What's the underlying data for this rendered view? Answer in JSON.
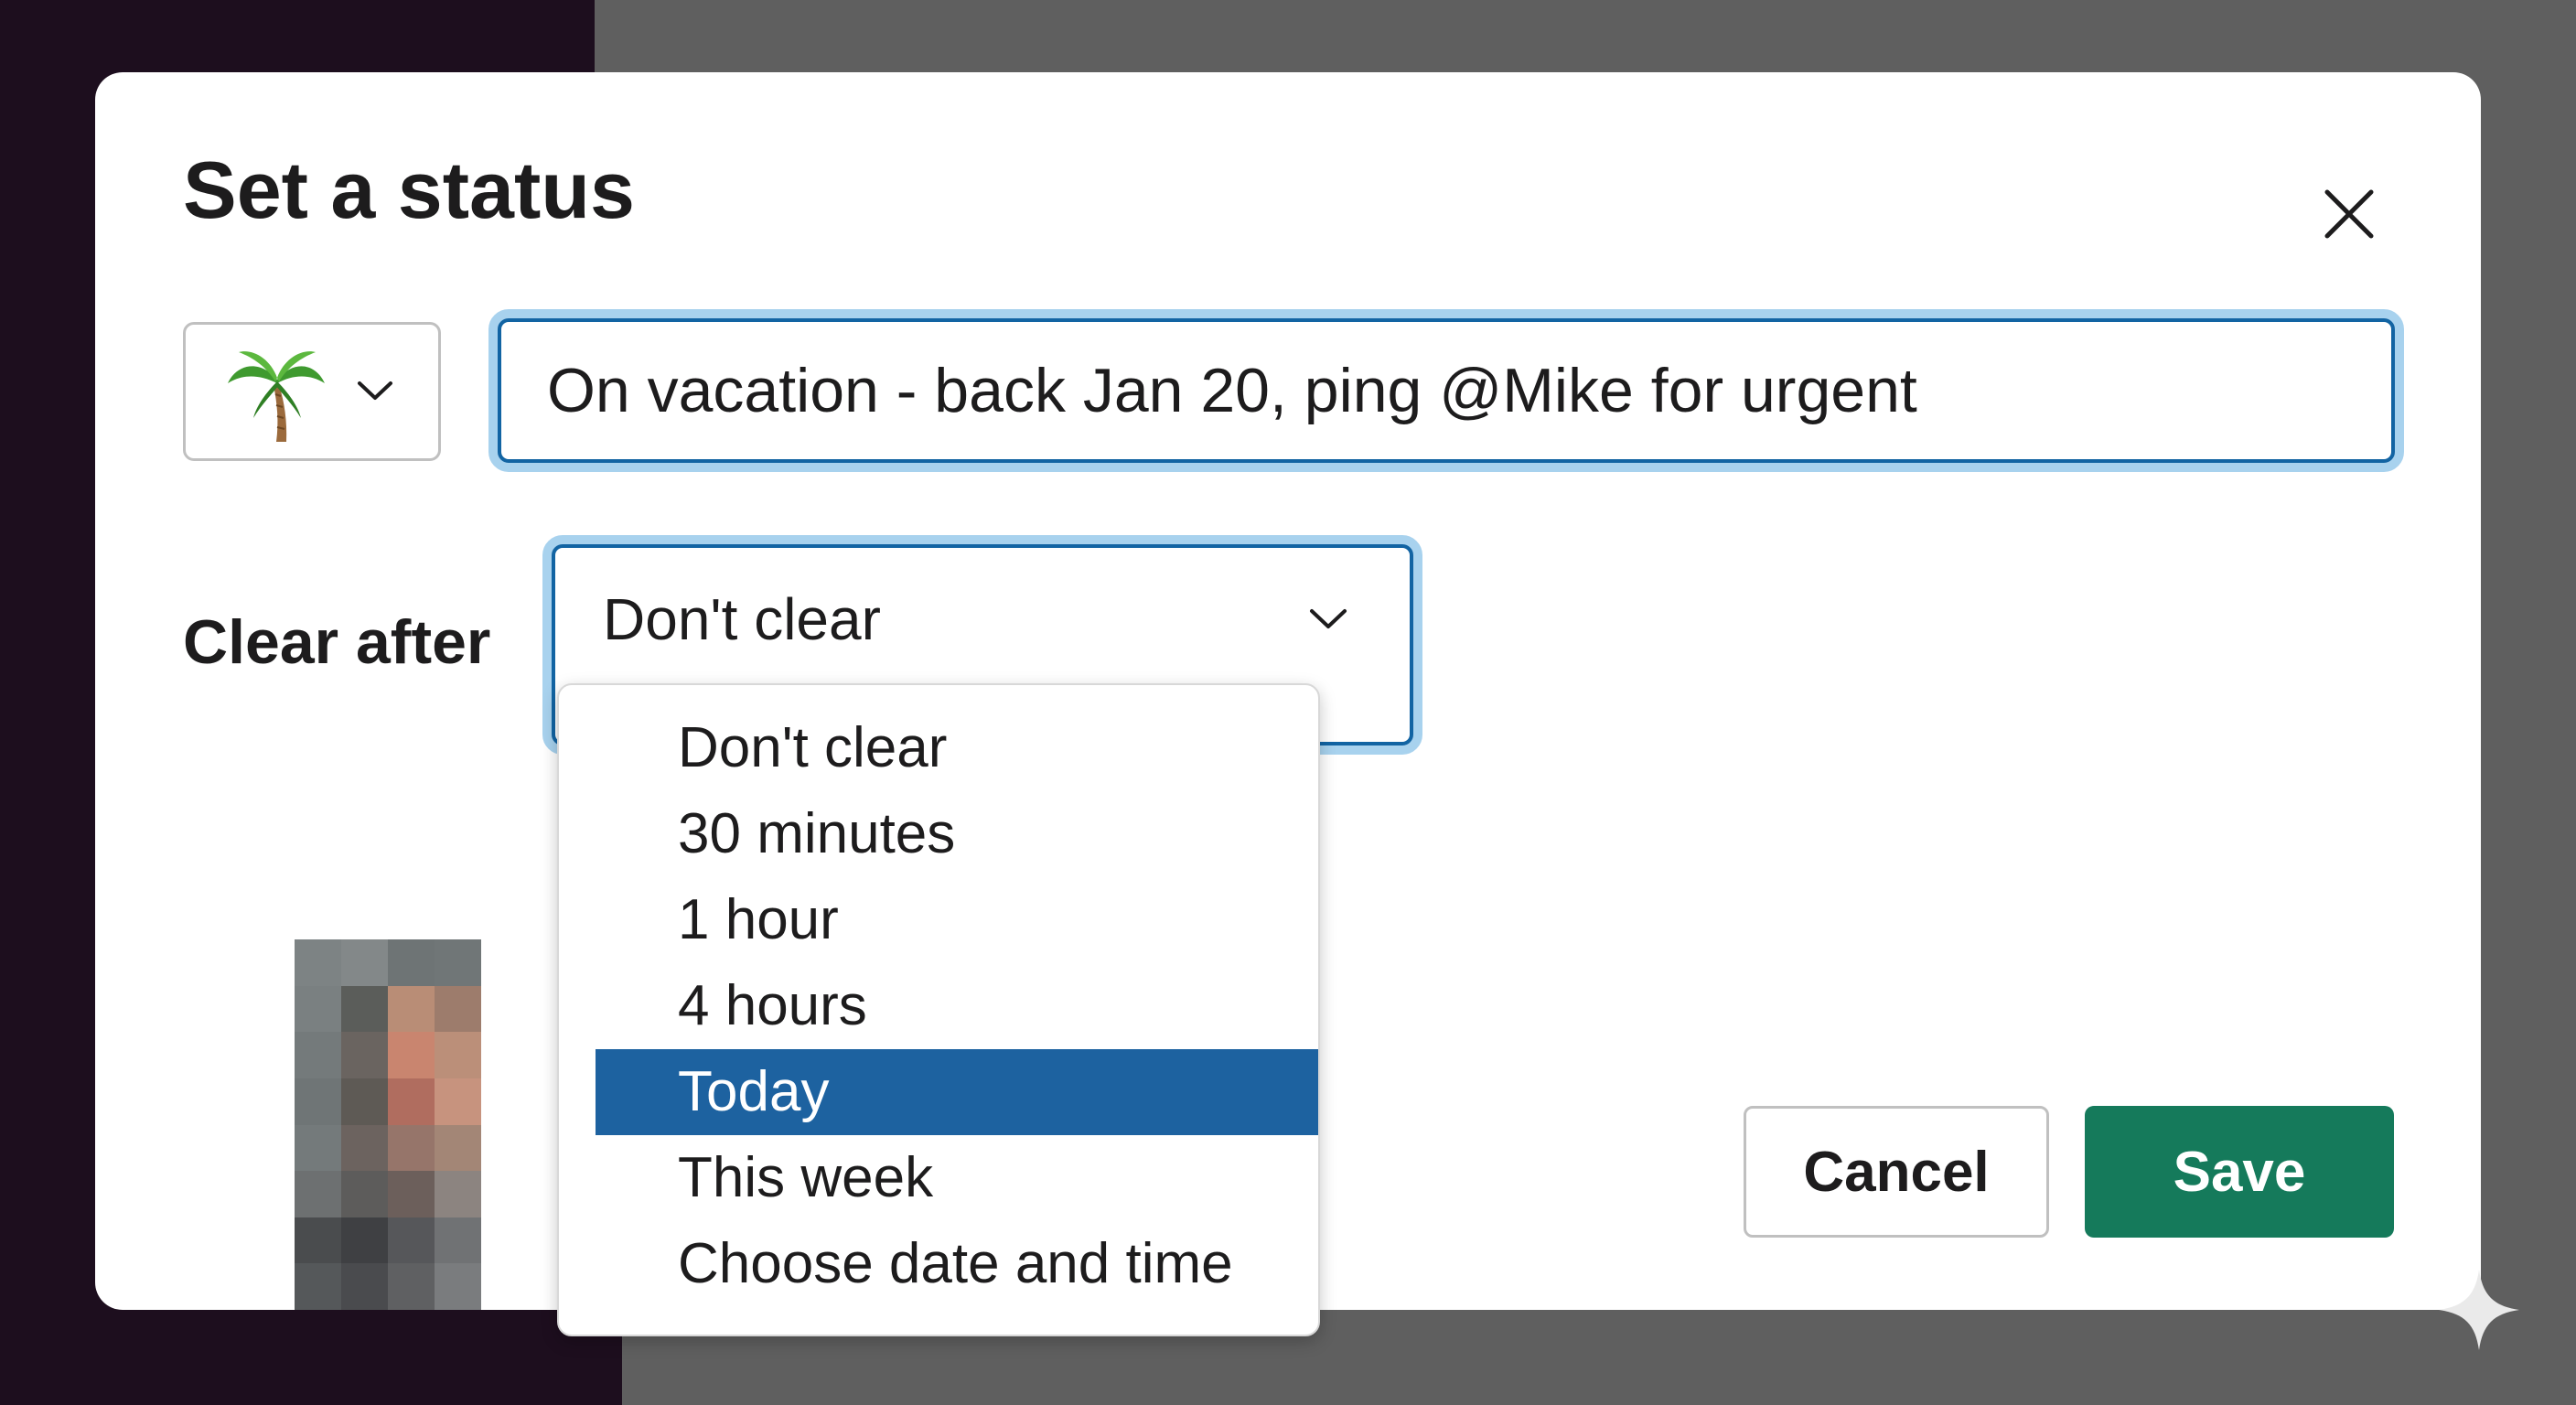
{
  "modal": {
    "title": "Set a status"
  },
  "status": {
    "emoji": "palm-tree-icon",
    "text": "On vacation - back Jan 20, ping @Mike for urgent"
  },
  "clear_after": {
    "label": "Clear after",
    "selected": "Don't clear",
    "options": [
      {
        "label": "Don't clear",
        "highlighted": false
      },
      {
        "label": "30 minutes",
        "highlighted": false
      },
      {
        "label": "1 hour",
        "highlighted": false
      },
      {
        "label": "4 hours",
        "highlighted": false
      },
      {
        "label": "Today",
        "highlighted": true
      },
      {
        "label": "This week",
        "highlighted": false
      },
      {
        "label": "Choose date and time",
        "highlighted": false
      }
    ]
  },
  "actions": {
    "cancel_label": "Cancel",
    "save_label": "Save"
  },
  "colors": {
    "primary_button": "#157a5b",
    "focus_border": "#1264a3",
    "focus_ring": "#a8d2ee",
    "highlight": "#1d62a0",
    "backdrop": "#5f5f5f",
    "sidebar": "#1d0e1e"
  }
}
